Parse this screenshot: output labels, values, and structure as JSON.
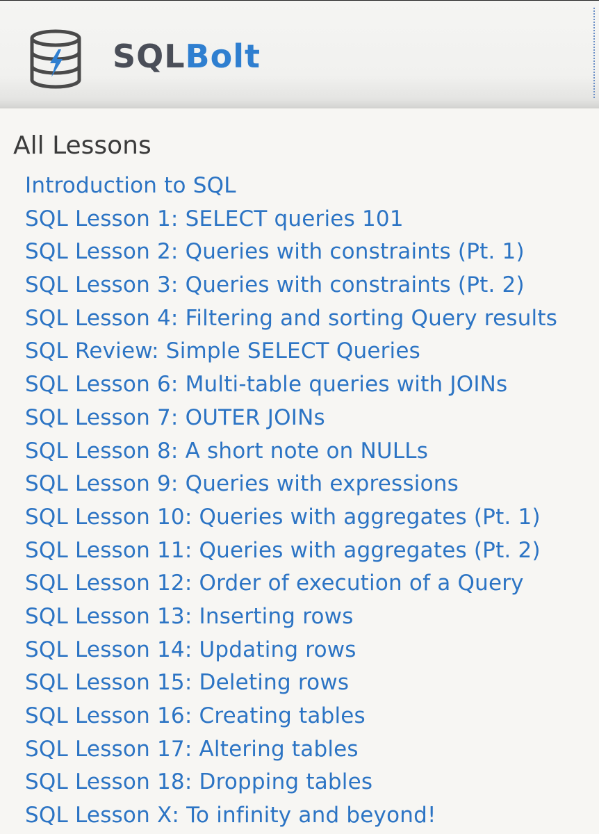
{
  "header": {
    "brand_part1": "SQL",
    "brand_part2": "Bolt",
    "logo_icon": "database-bolt-icon"
  },
  "colors": {
    "link": "#2c74c4",
    "brand_dark": "#4a4e58",
    "brand_accent": "#2f7fd0",
    "background": "#f7f6f3"
  },
  "sidebar": {
    "title": "All Lessons",
    "lessons": [
      "Introduction to SQL",
      "SQL Lesson 1: SELECT queries 101",
      "SQL Lesson 2: Queries with constraints (Pt. 1)",
      "SQL Lesson 3: Queries with constraints (Pt. 2)",
      "SQL Lesson 4: Filtering and sorting Query results",
      "SQL Review: Simple SELECT Queries",
      "SQL Lesson 6: Multi-table queries with JOINs",
      "SQL Lesson 7: OUTER JOINs",
      "SQL Lesson 8: A short note on NULLs",
      "SQL Lesson 9: Queries with expressions",
      "SQL Lesson 10: Queries with aggregates (Pt. 1)",
      "SQL Lesson 11: Queries with aggregates (Pt. 2)",
      "SQL Lesson 12: Order of execution of a Query",
      "SQL Lesson 13: Inserting rows",
      "SQL Lesson 14: Updating rows",
      "SQL Lesson 15: Deleting rows",
      "SQL Lesson 16: Creating tables",
      "SQL Lesson 17: Altering tables",
      "SQL Lesson 18: Dropping tables",
      "SQL Lesson X: To infinity and beyond!"
    ]
  }
}
